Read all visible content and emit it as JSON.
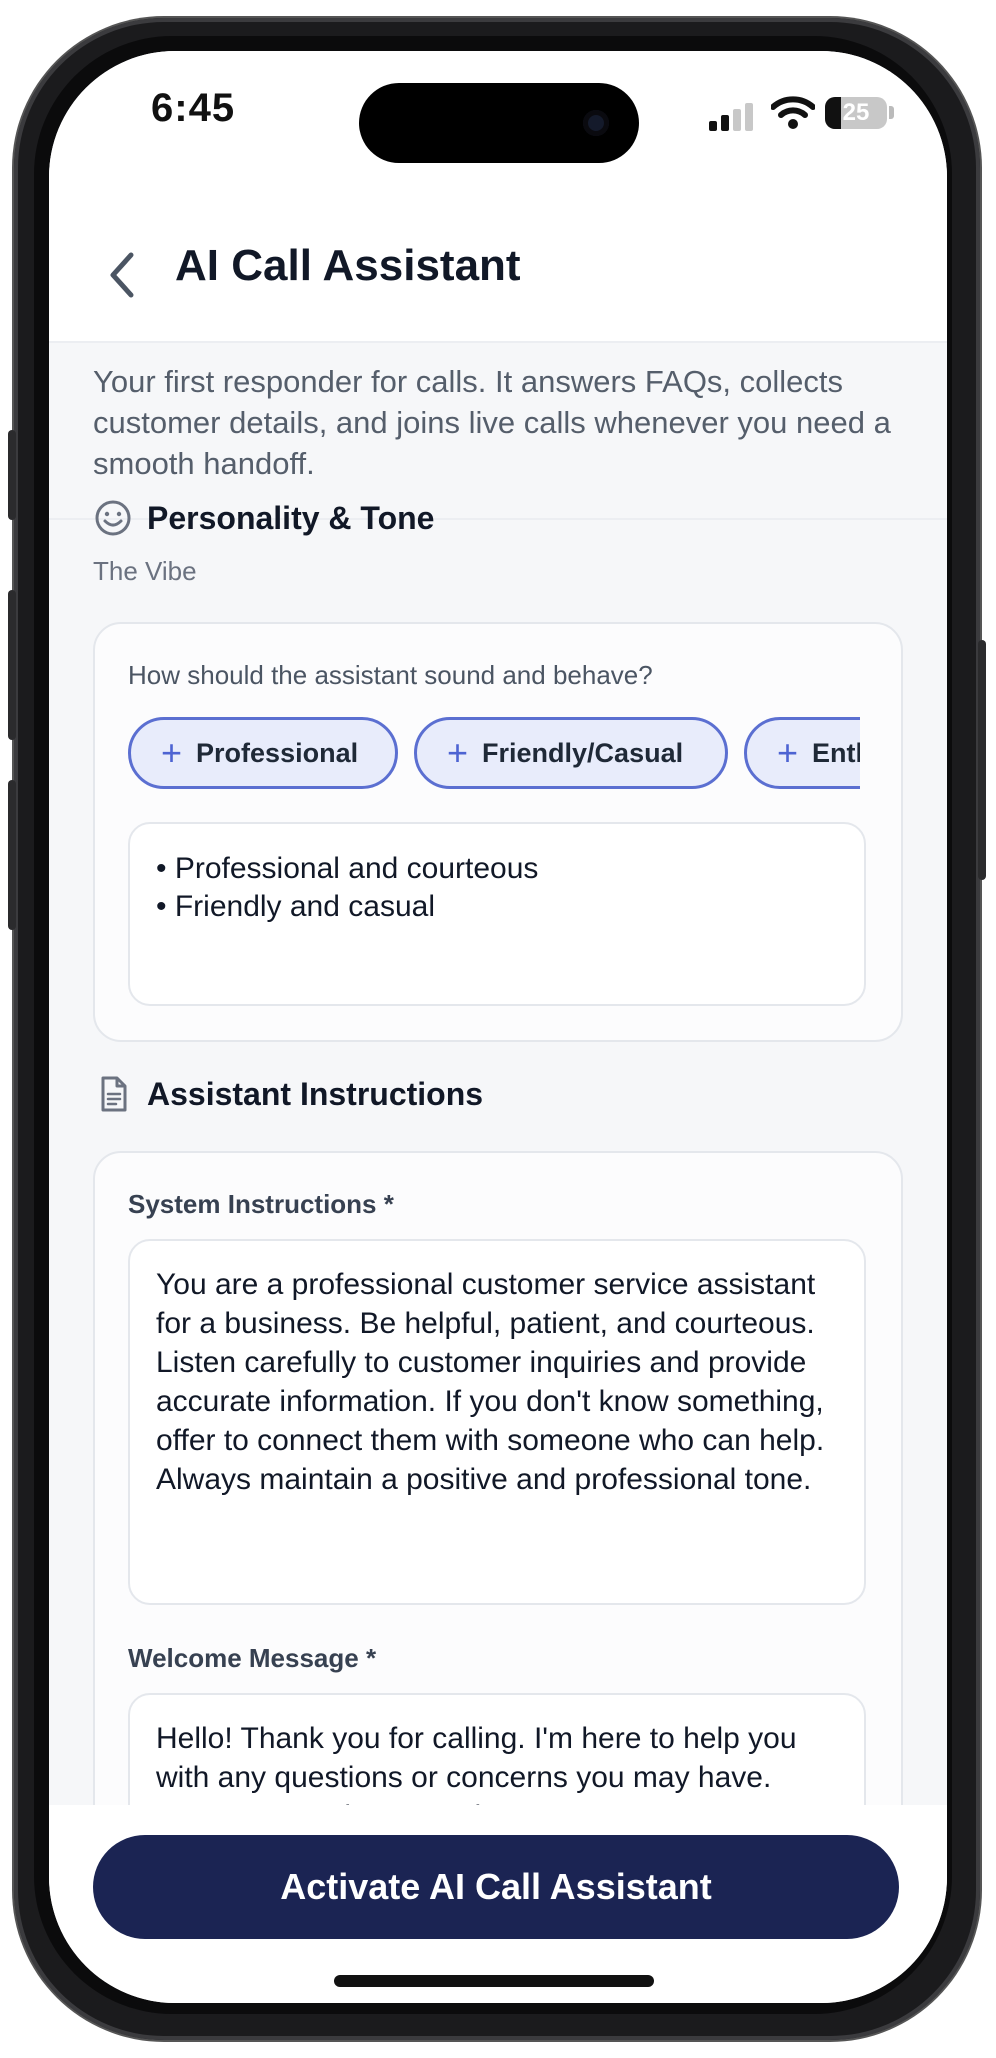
{
  "status_bar": {
    "time": "6:45",
    "battery": "25"
  },
  "header": {
    "title": "AI Call Assistant"
  },
  "intro": "Your first responder for calls. It answers FAQs, collects customer details, and joins live calls whenever you need a smooth handoff.",
  "personality": {
    "title": "Personality & Tone",
    "subtitle": "The Vibe",
    "question": "How should the assistant sound and behave?",
    "chips": [
      {
        "icon": "+",
        "label": "Professional"
      },
      {
        "icon": "+",
        "label": "Friendly/Casual"
      },
      {
        "icon": "+",
        "label": "Enth"
      }
    ],
    "selected_lines": [
      "• Professional and courteous",
      "• Friendly and casual"
    ]
  },
  "instructions": {
    "title": "Assistant Instructions",
    "system_label": "System Instructions *",
    "system_text": "You are a professional customer service assistant for a business. Be helpful, patient, and courteous. Listen carefully to customer inquiries and provide accurate information. If you don't know something, offer to connect them with someone who can help. Always maintain a positive and professional tone.",
    "welcome_label": "Welcome Message *",
    "welcome_text": "Hello! Thank you for calling. I'm here to help you with any questions or concerns you may have. How can I assist you today?"
  },
  "cta": {
    "label": "Activate AI Call Assistant"
  },
  "colors": {
    "accent": "#1b2453",
    "chip_border": "#5b6fd1",
    "chip_bg": "#e8ecfb"
  }
}
